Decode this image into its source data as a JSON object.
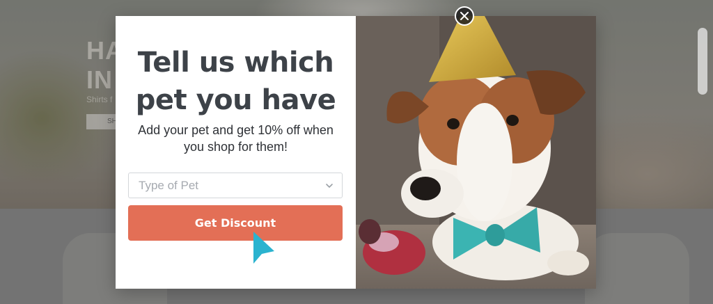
{
  "background": {
    "hero_title": "HA\nIN C",
    "hero_subtitle": "Shirts f",
    "hero_button": "SH"
  },
  "popup": {
    "headline": "Tell us which pet you have",
    "subtext": "Add your pet and get 10% off when you shop for them!",
    "pet_select": {
      "placeholder": "Type of Pet"
    },
    "cta_label": "Get Discount",
    "close_icon": "close-icon",
    "colors": {
      "headline": "#3d4248",
      "cta_background": "#e36f56",
      "cursor": "#2bb3cf"
    }
  }
}
